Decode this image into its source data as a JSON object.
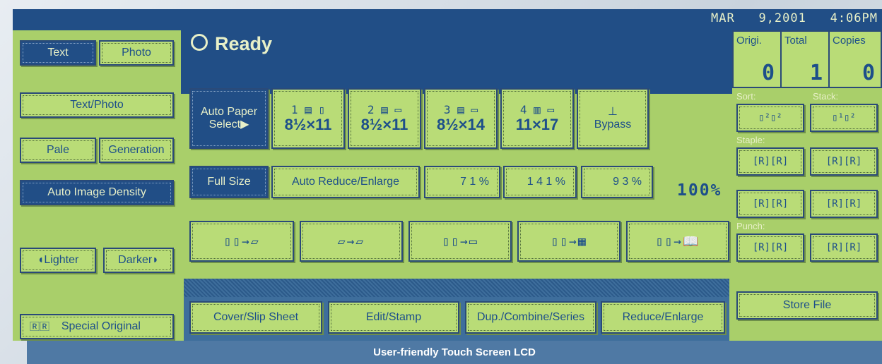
{
  "status_bar": {
    "date": "MAR",
    "day": "9,2001",
    "time": "4:06PM"
  },
  "header": {
    "status": "Ready"
  },
  "counters": [
    {
      "label": "Origi.",
      "value": "0"
    },
    {
      "label": "Total",
      "value": "1"
    },
    {
      "label": "Copies",
      "value": "0"
    }
  ],
  "left_panel": {
    "text": "Text",
    "photo": "Photo",
    "text_photo": "Text/Photo",
    "pale": "Pale",
    "generation": "Generation",
    "auto_density": "Auto Image Density",
    "lighter": "Lighter",
    "darker": "Darker",
    "special_original": "Special Original"
  },
  "paper": {
    "auto_select_line1": "Auto Paper",
    "auto_select_line2": "Select",
    "trays": [
      {
        "num": "1",
        "size": "8½×11"
      },
      {
        "num": "2",
        "size": "8½×11"
      },
      {
        "num": "3",
        "size": "8½×14"
      },
      {
        "num": "4",
        "size": "11×17"
      }
    ],
    "bypass": "Bypass"
  },
  "ratio": {
    "full_size": "Full Size",
    "auto_reduce": "Auto Reduce/Enlarge",
    "p71": "7 1 %",
    "p141": "1 4 1 %",
    "p93": "9 3 %",
    "current": "100%"
  },
  "bottom_tabs": {
    "cover": "Cover/Slip Sheet",
    "edit": "Edit/Stamp",
    "dup": "Dup./Combine/Series",
    "reduce": "Reduce/Enlarge"
  },
  "finishing": {
    "sort": "Sort:",
    "stack": "Stack:",
    "staple": "Staple:",
    "punch": "Punch:",
    "store_file": "Store File"
  },
  "caption": "User-friendly Touch Screen LCD"
}
